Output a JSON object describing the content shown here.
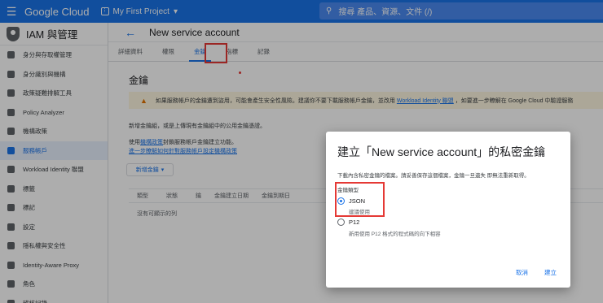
{
  "topbar": {
    "menu_icon": "hamburger-icon",
    "logo": "Google Cloud",
    "project_name": "My First Project",
    "search_placeholder": "搜尋 產品、資源、文件 (/)"
  },
  "sidebar": {
    "title": "IAM 與管理",
    "items": [
      {
        "label": "身分與存取權管理",
        "icon": "person-add-icon"
      },
      {
        "label": "身分識別與機構",
        "icon": "account-circle-icon"
      },
      {
        "label": "政策疑難排解工具",
        "icon": "wrench-icon"
      },
      {
        "label": "Policy Analyzer",
        "icon": "search-doc-icon"
      },
      {
        "label": "機構政策",
        "icon": "policy-icon"
      },
      {
        "label": "服務帳戶",
        "icon": "service-account-icon",
        "active": true
      },
      {
        "label": "Workload Identity 聯盟",
        "icon": "workload-icon"
      },
      {
        "label": "標籤",
        "icon": "label-icon"
      },
      {
        "label": "標記",
        "icon": "tag-icon"
      },
      {
        "label": "設定",
        "icon": "settings-icon"
      },
      {
        "label": "隱私權與安全性",
        "icon": "shield-icon"
      },
      {
        "label": "Identity-Aware Proxy",
        "icon": "proxy-icon"
      },
      {
        "label": "角色",
        "icon": "roles-icon"
      },
      {
        "label": "稽核記錄",
        "icon": "audit-icon"
      }
    ]
  },
  "header": {
    "title": "New service account"
  },
  "tabs": [
    "詳細資料",
    "權限",
    "金鑰",
    "指標",
    "記錄"
  ],
  "content": {
    "section_title": "金鑰",
    "warning_text": "如果服務帳戶的金鑰遭到盜用，可能會產生安全性風險。建議你不要下載服務帳戶金鑰，並改用",
    "warning_link": "Workload Identity 聯盟",
    "warning_tail": "，如要進一步瞭解在 Google Cloud 中驗證服務",
    "p1": "新增金鑰組，或是上傳現有金鑰組中的公用金鑰憑證。",
    "p2_prefix": "使用",
    "p2_link": "機構政策",
    "p2_suffix": "封鎖服務帳戶金鑰建立功能。",
    "p3": "進一步瞭解如何針對服務帳戶設定機構政策",
    "add_key_button": "新增金鑰",
    "table_headers": [
      "類型",
      "狀態",
      "鑰",
      "金鑰建立日期",
      "金鑰到期日"
    ],
    "table_empty": "沒有可顯示的列"
  },
  "dialog": {
    "title": "建立「New service account」的私密金鑰",
    "description": "下載內含私密金鑰的檔案。請妥善保存這個檔案，金鑰一旦遺失 即無法重新取得。",
    "key_type_label": "金鑰類型",
    "options": [
      {
        "label": "JSON",
        "sub": "建議使用",
        "selected": true
      },
      {
        "label": "P12",
        "sub": "新用使用 P12 格式的程式碼的向下相容",
        "selected": false
      }
    ],
    "cancel": "取消",
    "create": "建立"
  }
}
